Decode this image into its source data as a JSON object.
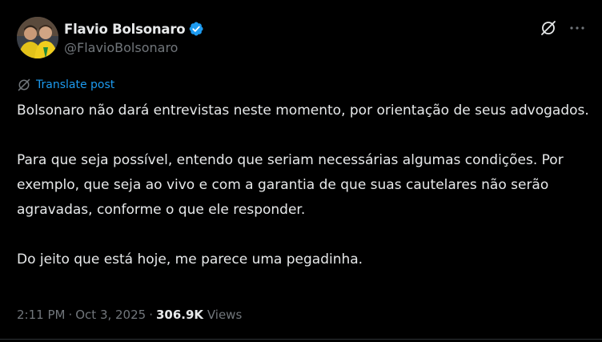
{
  "author": {
    "display_name": "Flavio Bolsonaro",
    "handle": "@FlavioBolsonaro",
    "verified": true
  },
  "icons": {
    "verified": "verified-badge-icon",
    "grok": "grok-icon",
    "more": "more-options-icon",
    "translate": "translate-icon"
  },
  "translate": {
    "label": "Translate post"
  },
  "post": {
    "paragraphs": [
      "Bolsonaro não dará entrevistas neste momento, por orientação de seus advogados.",
      "Para que seja possível, entendo que seriam necessárias algumas condições. Por exemplo, que seja ao vivo e com a garantia de que suas cautelares não serão agravadas, conforme o que ele responder.",
      "Do jeito que está hoje, me parece uma pegadinha."
    ]
  },
  "meta": {
    "time": "2:11 PM",
    "separator": "·",
    "date": "Oct 3, 2025",
    "views_count": "306.9K",
    "views_label": "Views"
  },
  "colors": {
    "background": "#000000",
    "text": "#e7e9ea",
    "secondary": "#71767b",
    "accent": "#1d9bf0"
  }
}
